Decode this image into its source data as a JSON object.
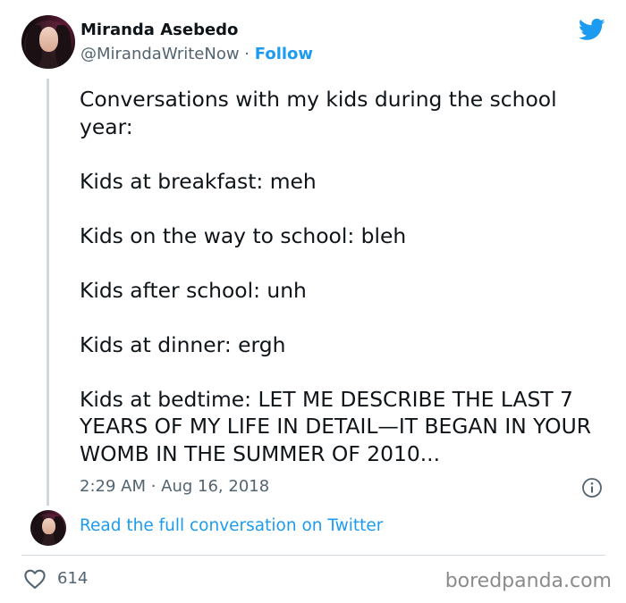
{
  "author": {
    "name": "Miranda Asebedo",
    "handle": "@MirandaWriteNow",
    "separator": "·",
    "follow_label": "Follow"
  },
  "icons": {
    "brand": "twitter-bird-icon",
    "info": "info-icon",
    "like": "heart-icon"
  },
  "colors": {
    "accent": "#1d9bf0",
    "text": "#0f1419",
    "muted": "#536471",
    "divider": "#cfd9de"
  },
  "tweet": {
    "text": "Conversations with my kids during the school year:\n\nKids at breakfast: meh\n\nKids on the way to school: bleh\n\nKids after school: unh\n\nKids at dinner: ergh\n\nKids at bedtime: LET ME DESCRIBE THE LAST 7 YEARS OF MY LIFE IN DETAIL—IT BEGAN IN YOUR WOMB IN THE SUMMER OF 2010...",
    "timestamp": "2:29 AM · Aug 16, 2018"
  },
  "thread": {
    "link_label": "Read the full conversation on Twitter"
  },
  "footer": {
    "likes": "614",
    "watermark": "boredpanda.com"
  }
}
